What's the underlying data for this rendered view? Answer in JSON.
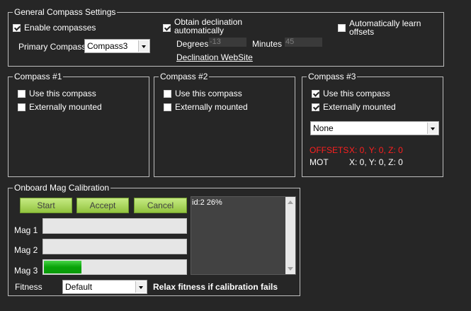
{
  "general": {
    "title": "General Compass Settings",
    "enable_compasses": "Enable compasses",
    "primary_compass_label": "Primary Compass:",
    "primary_compass_value": "Compass3",
    "obtain_declination_line1": "Obtain declination",
    "obtain_declination_line2": "automatically",
    "degrees_label": "Degrees",
    "degrees_value": "-13",
    "minutes_label": "Minutes",
    "minutes_value": "45",
    "declination_link": "Declination WebSite",
    "auto_learn_line1": "Automatically learn",
    "auto_learn_line2": "offsets"
  },
  "compass1": {
    "title": "Compass #1",
    "use": "Use this compass",
    "external": "Externally mounted"
  },
  "compass2": {
    "title": "Compass #2",
    "use": "Use this compass",
    "external": "Externally mounted"
  },
  "compass3": {
    "title": "Compass #3",
    "use": "Use this compass",
    "external": "Externally mounted",
    "orientation_value": "None",
    "offsets_label": "OFFSETS",
    "offsets_values": "X: 0,   Y: 0,   Z: 0",
    "mot_label": "MOT",
    "mot_values": "X: 0,   Y: 0,   Z: 0"
  },
  "calibration": {
    "title": "Onboard Mag Calibration",
    "start": "Start",
    "accept": "Accept",
    "cancel": "Cancel",
    "mag1": "Mag 1",
    "mag2": "Mag 2",
    "mag3": "Mag 3",
    "mag1_progress": 0,
    "mag2_progress": 0,
    "mag3_progress": 0.26,
    "log_text": "id:2 26%",
    "fitness_label": "Fitness",
    "fitness_value": "Default",
    "relax_label": "Relax fitness if calibration fails"
  },
  "colors": {
    "background": "#262626",
    "accent_green": "#92c43f",
    "progress_green": "#09a409",
    "offsets_red": "#ff1f1f"
  }
}
